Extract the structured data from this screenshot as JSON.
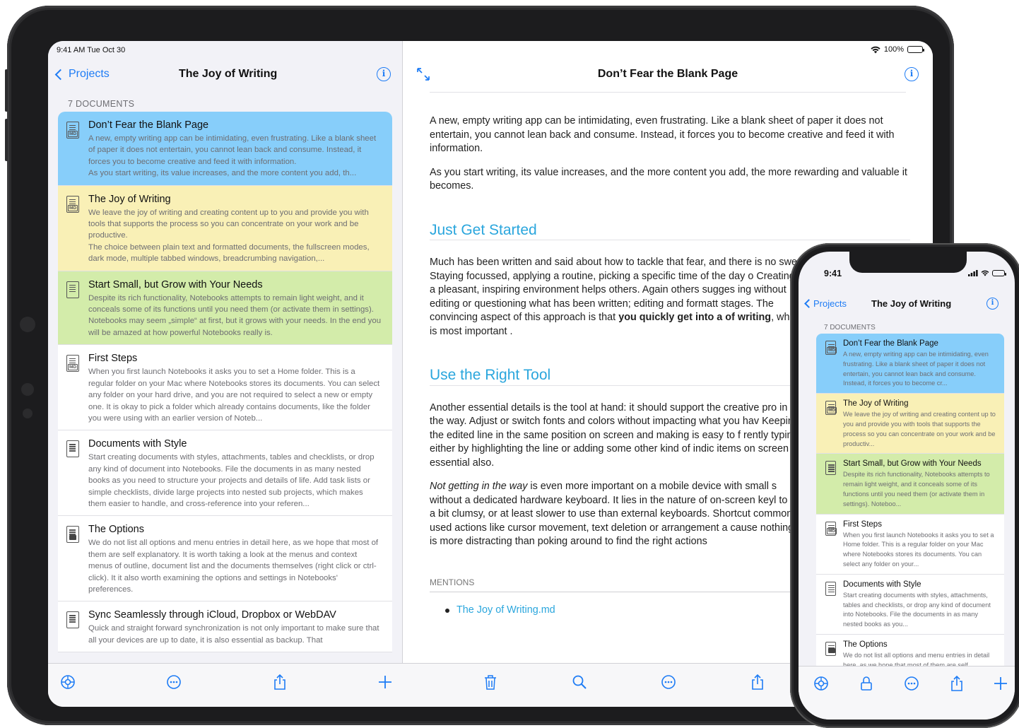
{
  "ipad": {
    "status": {
      "time": "9:41 AM  Tue Oct 30",
      "battery": "100%"
    },
    "sidebar": {
      "back_label": "Projects",
      "title": "The Joy of Writing",
      "section_header": "7 DOCUMENTS",
      "documents": [
        {
          "title": "Don’t Fear the Blank Page",
          "color": "#87cefa",
          "icon": "markdown-doc-icon",
          "preview": "A new, empty writing app can be intimidating, even frustrating. Like a blank sheet of paper it does not entertain, you cannot lean back and consume. Instead, it forces you to become creative and feed it with information.\nAs you start writing, its value increases, and the more content you add, th..."
        },
        {
          "title": "The Joy of Writing",
          "color": "#f9f0b6",
          "icon": "markdown-doc-icon",
          "preview": "We leave the joy of writing and creating content up to you and provide you with tools that supports the process so you can concentrate on your work and be productive.\nThe choice between plain text and formatted documents, the fullscreen modes, dark mode, multiple tabbed windows, breadcrumbing navigation,..."
        },
        {
          "title": "Start Small, but Grow with Your Needs",
          "color": "#d3ecaa",
          "icon": "text-doc-icon",
          "preview": "Despite its rich functionality, Notebooks attempts to remain light weight, and it conceals some of its functions until you need them (or activate them in settings). Notebooks may seem „simple“ at first, but it grows with your needs. In the end you will be amazed at how powerful Notebooks really is."
        },
        {
          "title": "First Steps",
          "color": "#ffffff",
          "icon": "markdown-doc-icon",
          "preview": "When you first launch Notebooks it asks you to set a Home folder. This is a regular folder on your Mac where Notebooks stores its documents. You can select any folder on your hard drive, and you are not required to select a new or empty one. It is okay to pick a folder which already contains documents, like the folder you were using with an earlier version of Noteb..."
        },
        {
          "title": "Documents with Style",
          "color": "#ffffff",
          "icon": "text-doc-icon",
          "preview": "Start creating documents with styles, attachments, tables and checklists, or drop any kind of document into Notebooks. File the documents in as many nested books as you need to structure your projects and details of life. Add task lists or simple checklists, divide large projects into nested sub projects, which makes them easier to handle, and cross-reference into your referen..."
        },
        {
          "title": "The Options",
          "color": "#ffffff",
          "icon": "image-doc-icon",
          "preview": "We do not list all options and menu entries in detail here, as we hope that most of them are self explanatory. It is worth taking a look at the menus and context menus of outline, document list and the documents themselves (right click or ctrl-click). It it also worth examining the options and settings in Notebooks' preferences."
        },
        {
          "title": "Sync Seamlessly through iCloud, Dropbox or WebDAV",
          "color": "#ffffff",
          "icon": "text-doc-icon",
          "preview": "Quick and straight forward synchronization is not only important to make sure that all your devices are up to date, it is also essential as backup. That"
        }
      ],
      "toolbar": [
        "settings-gear-icon",
        "more-ellipsis-icon",
        "share-icon",
        "add-plus-icon"
      ]
    },
    "editor": {
      "title": "Don’t Fear the Blank Page",
      "p1": "A new, empty writing app can be intimidating, even frustrating. Like a blank sheet of paper it does not entertain, you cannot lean back and consume. Instead, it forces you to become creative and feed it with information.",
      "p2": "As you start writing, its value increases, and the more content you add, the more rewarding and valuable it becomes.",
      "h1": "Just Get Started",
      "p3_start": "Much has been written and said about how to tackle that fear, and there is no swer. Staying focussed, applying a routine, picking a specific time of the day o Creating a pleasant, inspiring environment helps others. Again others sugges ing without editing or questioning what has been written; editing and formatt stages. The convincing aspect of this approach is that ",
      "p3_bold": "you quickly get into a of writing",
      "p3_end": ", which is most important .",
      "h2": "Use the Right Tool",
      "p4": "Another essential details is the tool at hand: it should support the creative pro in the way. Adjust or switch fonts and colors without impacting what you hav Keeping the edited line in the same position on screen and making is easy to f rently typing, either by highlighting the line or adding some other kind of indic items on screen is essential also.",
      "p5_italic": "Not getting in the way",
      "p5_rest": " is even more important on a mobile device with small s without a dedicated hardware keyboard. It lies in the nature of on-screen keyl to be a bit clumsy, or at least slower to use than external keyboards. Shortcut commonly used actions like cursor movement, text deletion or arrangement a cause nothing is more distracting than poking around to find the right actions",
      "mentions_label": "MENTIONS",
      "mention_link": "The Joy of Writing.md",
      "toolbar": [
        "trash-icon",
        "search-icon",
        "more-ellipsis-icon",
        "share-icon"
      ]
    }
  },
  "iphone": {
    "status": {
      "time": "9:41"
    },
    "back_label": "Projects",
    "title": "The Joy of Writing",
    "section_header": "7 DOCUMENTS",
    "documents": [
      {
        "title": "Don’t Fear the Blank Page",
        "color": "#87cefa",
        "preview": "A new, empty writing app can be intimidating, even frustrating. Like a blank sheet of paper it does not entertain, you cannot lean back and consume. Instead, it forces you to become cr..."
      },
      {
        "title": "The Joy of Writing",
        "color": "#f9f0b6",
        "preview": "We leave the joy of writing and creating content up to you and provide you with tools that supports the process so you can concentrate on your work and be productiv..."
      },
      {
        "title": "Start Small, but Grow with Your Needs",
        "color": "#d3ecaa",
        "preview": "Despite its rich functionality, Notebooks attempts to remain light weight, and it conceals some of its functions until you need them (or activate them in settings). Noteboo..."
      },
      {
        "title": "First Steps",
        "color": "#ffffff",
        "preview": "When you first launch Notebooks it asks you to set a Home folder. This is a regular folder on your Mac where Notebooks stores its documents. You can select any folder on your..."
      },
      {
        "title": "Documents with Style",
        "color": "#ffffff",
        "preview": "Start creating documents with styles, attachments, tables and checklists, or drop any kind of document into Notebooks. File the documents in as many nested books as you..."
      },
      {
        "title": "The Options",
        "color": "#ffffff",
        "preview": "We do not list all options and menu entries in detail here, as we hope that most of them are self explanatory. It is worth taking a look at"
      }
    ],
    "toolbar": [
      "settings-gear-icon",
      "lock-icon",
      "more-ellipsis-icon",
      "share-icon",
      "add-plus-icon"
    ]
  },
  "colors": {
    "accent": "#1e7cf5",
    "heading": "#2aa6dd"
  }
}
